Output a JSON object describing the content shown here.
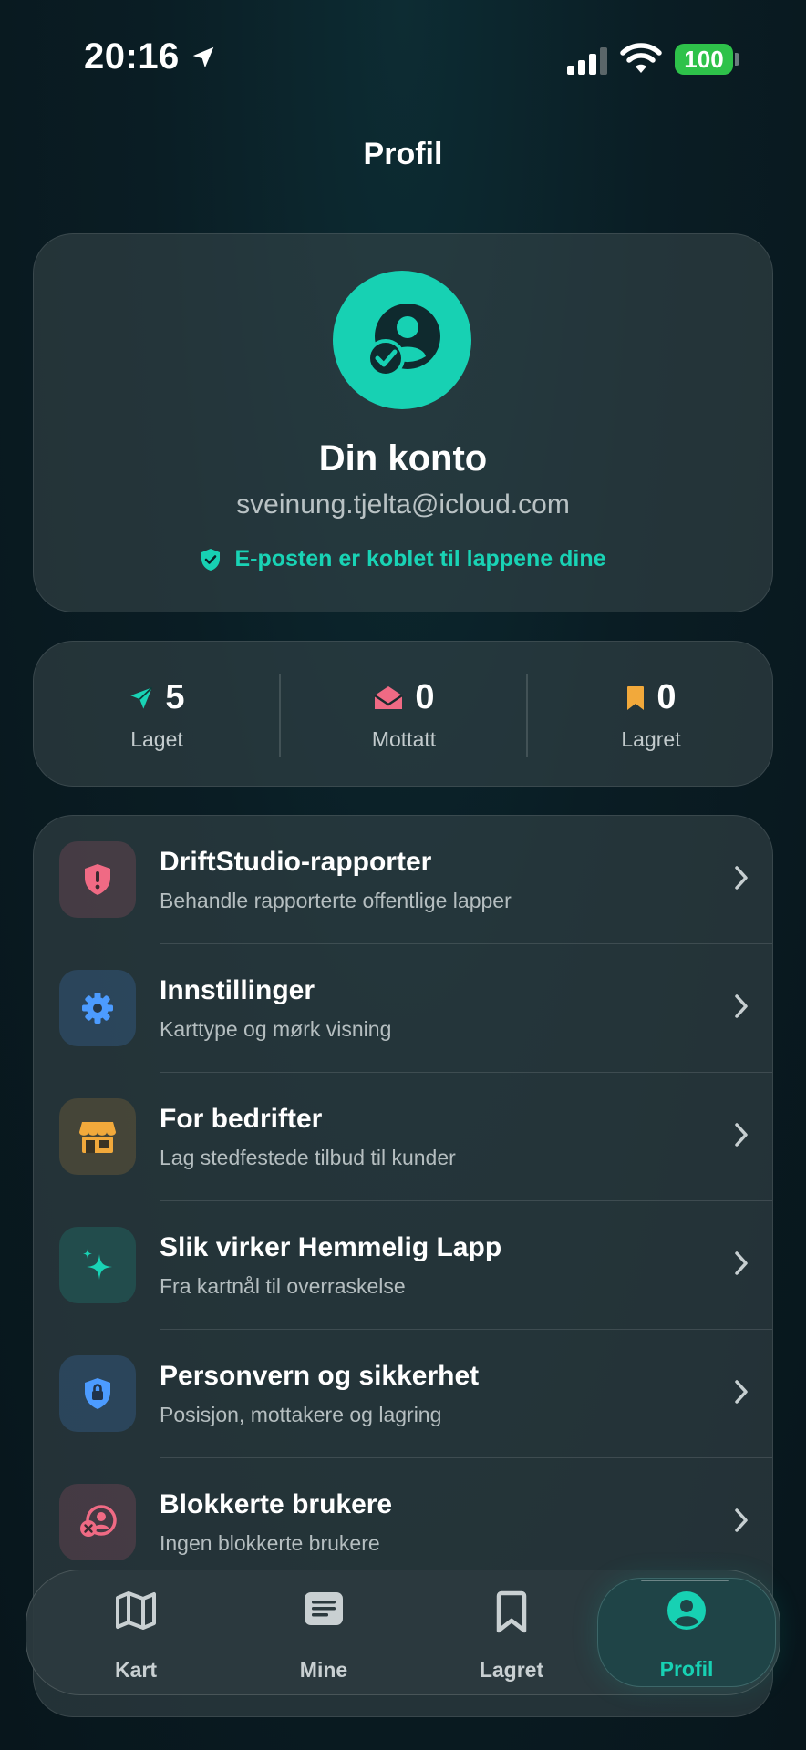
{
  "status_bar": {
    "time": "20:16",
    "battery": "100"
  },
  "page": {
    "title": "Profil"
  },
  "account": {
    "title": "Din konto",
    "email": "sveinung.tjelta@icloud.com",
    "verified_text": "E-posten er koblet til lappene dine",
    "accent_color": "#17d1b3"
  },
  "stats": [
    {
      "value": "5",
      "label": "Laget",
      "icon": "send-icon",
      "color": "#19d3b5"
    },
    {
      "value": "0",
      "label": "Mottatt",
      "icon": "envelope-open-icon",
      "color": "#f06a84"
    },
    {
      "value": "0",
      "label": "Lagret",
      "icon": "bookmark-icon",
      "color": "#f2a93b"
    }
  ],
  "menu": [
    {
      "title": "DriftStudio-rapporter",
      "subtitle": "Behandle rapporterte offentlige lapper",
      "icon": "shield-alert-icon",
      "color": "#f06a84"
    },
    {
      "title": "Innstillinger",
      "subtitle": "Karttype og mørk visning",
      "icon": "gear-icon",
      "color": "#4c9bff"
    },
    {
      "title": "For bedrifter",
      "subtitle": "Lag stedfestede tilbud til kunder",
      "icon": "storefront-icon",
      "color": "#f2a93b"
    },
    {
      "title": "Slik virker Hemmelig Lapp",
      "subtitle": "Fra kartnål til overraskelse",
      "icon": "sparkles-icon",
      "color": "#19d3b5"
    },
    {
      "title": "Personvern og sikkerhet",
      "subtitle": "Posisjon, mottakere og lagring",
      "icon": "shield-lock-icon",
      "color": "#4c9bff"
    },
    {
      "title": "Blokkerte brukere",
      "subtitle": "Ingen blokkerte brukere",
      "icon": "person-blocked-icon",
      "color": "#f06a84"
    }
  ],
  "tabs": [
    {
      "label": "Kart",
      "icon": "map-icon"
    },
    {
      "label": "Mine",
      "icon": "note-icon"
    },
    {
      "label": "Lagret",
      "icon": "bookmark-icon"
    },
    {
      "label": "Profil",
      "icon": "person-circle-icon",
      "active": true
    }
  ]
}
